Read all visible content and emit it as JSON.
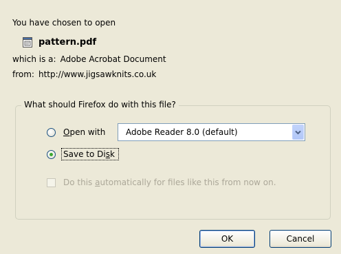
{
  "dialog": {
    "heading": "You have chosen to open",
    "file": {
      "name": "pattern.pdf",
      "icon": "pdf-file-icon"
    },
    "type_label": "which is a:",
    "type_value": "Adobe Acrobat Document",
    "from_label": "from:",
    "from_value": "http://www.jigsawknits.co.uk",
    "group": {
      "legend": "What should Firefox do with this file?",
      "open_with": {
        "prefix": "",
        "accel": "O",
        "rest": "pen with",
        "checked": false
      },
      "app_select": {
        "value": "Adobe Reader 8.0 (default)",
        "icon": "chevron-down-icon"
      },
      "save_to_disk": {
        "before": "Save to Di",
        "accel": "s",
        "after": "k",
        "checked": true
      },
      "auto_checkbox": {
        "before": "Do this ",
        "accel": "a",
        "after": "utomatically for files like this from now on.",
        "checked": false,
        "disabled": true
      }
    },
    "buttons": {
      "ok": "OK",
      "cancel": "Cancel"
    }
  },
  "colors": {
    "background": "#ece9d8",
    "radio_checked": "#3da832",
    "disabled_text": "#aca899",
    "button_border": "#003c74"
  }
}
